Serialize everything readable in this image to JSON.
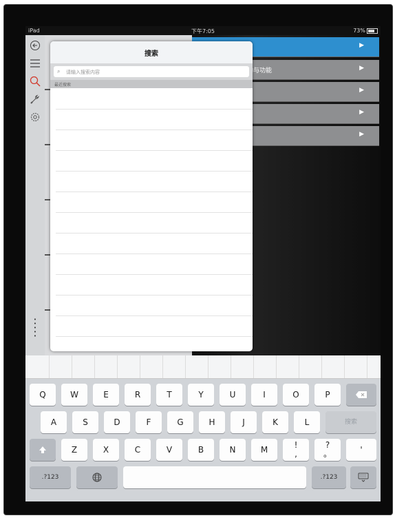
{
  "statusbar": {
    "device": "iPad",
    "time": "下午7:05",
    "battery": "73%"
  },
  "popover": {
    "title": "搜索",
    "search_placeholder": "请输入搜索内容",
    "section_label": "最近搜索"
  },
  "main_rows": [
    {
      "label": "",
      "active": true
    },
    {
      "label": "构与功能",
      "active": false
    },
    {
      "label": "",
      "active": false
    },
    {
      "label": "",
      "active": false
    },
    {
      "label": "",
      "active": false
    }
  ],
  "sidebar": {
    "icons": [
      "back-icon",
      "menu-icon",
      "search-icon",
      "tools-icon",
      "settings-icon"
    ]
  },
  "keyboard": {
    "row1": [
      "Q",
      "W",
      "E",
      "R",
      "T",
      "Y",
      "U",
      "I",
      "O",
      "P"
    ],
    "row2": [
      "A",
      "S",
      "D",
      "F",
      "G",
      "H",
      "J",
      "K",
      "L"
    ],
    "search_key": "搜索",
    "row3": [
      "Z",
      "X",
      "C",
      "V",
      "B",
      "N",
      "M"
    ],
    "punct1_top": "!",
    "punct1_bottom": ",",
    "punct2_top": "?",
    "punct2_bottom": "。",
    "comma": "'",
    "numbers_key": ".?123",
    "numbers_key_right": ".?123"
  },
  "colors": {
    "accent": "#2e8fcf",
    "search_icon": "#d13b2e"
  }
}
